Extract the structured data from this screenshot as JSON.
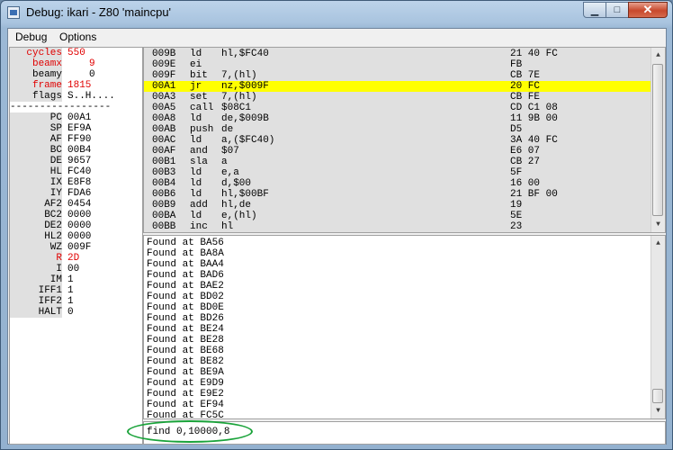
{
  "window": {
    "title": "Debug: ikari - Z80 'maincpu'"
  },
  "titlebar_buttons": {
    "minimize": "▁",
    "maximize": "□",
    "close": "✕"
  },
  "menu": [
    "Debug",
    "Options"
  ],
  "registers": [
    {
      "name": "cycles",
      "value": "550",
      "red": true
    },
    {
      "name": "beamx",
      "value": "9",
      "red": true
    },
    {
      "name": "beamy",
      "value": "0",
      "red": false
    },
    {
      "name": "frame",
      "value": "1815",
      "red": true
    },
    {
      "name": "flags",
      "value": "S..H....",
      "red": false
    },
    {
      "sep": "-----------------"
    },
    {
      "name": "PC",
      "value": "00A1",
      "red": false
    },
    {
      "name": "SP",
      "value": "EF9A",
      "red": false
    },
    {
      "name": "AF",
      "value": "FF90",
      "red": false
    },
    {
      "name": "BC",
      "value": "00B4",
      "red": false
    },
    {
      "name": "DE",
      "value": "9657",
      "red": false
    },
    {
      "name": "HL",
      "value": "FC40",
      "red": false
    },
    {
      "name": "IX",
      "value": "E8F8",
      "red": false
    },
    {
      "name": "IY",
      "value": "FDA6",
      "red": false
    },
    {
      "name": "AF2",
      "value": "0454",
      "red": false
    },
    {
      "name": "BC2",
      "value": "0000",
      "red": false
    },
    {
      "name": "DE2",
      "value": "0000",
      "red": false
    },
    {
      "name": "HL2",
      "value": "0000",
      "red": false
    },
    {
      "name": "WZ",
      "value": "009F",
      "red": false
    },
    {
      "name": "R",
      "value": "2D",
      "red": true
    },
    {
      "name": "I",
      "value": "00",
      "red": false
    },
    {
      "name": "IM",
      "value": "1",
      "red": false
    },
    {
      "name": "IFF1",
      "value": "1",
      "red": false
    },
    {
      "name": "IFF2",
      "value": "1",
      "red": false
    },
    {
      "name": "HALT",
      "value": "0",
      "red": false
    }
  ],
  "disassembly": [
    {
      "addr": "009B",
      "mnemonic": "ld",
      "operands": "hl,$FC40",
      "bytes": "21 40 FC",
      "highlight": false
    },
    {
      "addr": "009E",
      "mnemonic": "ei",
      "operands": "",
      "bytes": "FB",
      "highlight": false
    },
    {
      "addr": "009F",
      "mnemonic": "bit",
      "operands": "7,(hl)",
      "bytes": "CB 7E",
      "highlight": false
    },
    {
      "addr": "00A1",
      "mnemonic": "jr",
      "operands": "nz,$009F",
      "bytes": "20 FC",
      "highlight": true
    },
    {
      "addr": "00A3",
      "mnemonic": "set",
      "operands": "7,(hl)",
      "bytes": "CB FE",
      "highlight": false
    },
    {
      "addr": "00A5",
      "mnemonic": "call",
      "operands": "$08C1",
      "bytes": "CD C1 08",
      "highlight": false
    },
    {
      "addr": "00A8",
      "mnemonic": "ld",
      "operands": "de,$009B",
      "bytes": "11 9B 00",
      "highlight": false
    },
    {
      "addr": "00AB",
      "mnemonic": "push",
      "operands": "de",
      "bytes": "D5",
      "highlight": false
    },
    {
      "addr": "00AC",
      "mnemonic": "ld",
      "operands": "a,($FC40)",
      "bytes": "3A 40 FC",
      "highlight": false
    },
    {
      "addr": "00AF",
      "mnemonic": "and",
      "operands": "$07",
      "bytes": "E6 07",
      "highlight": false
    },
    {
      "addr": "00B1",
      "mnemonic": "sla",
      "operands": "a",
      "bytes": "CB 27",
      "highlight": false
    },
    {
      "addr": "00B3",
      "mnemonic": "ld",
      "operands": "e,a",
      "bytes": "5F",
      "highlight": false
    },
    {
      "addr": "00B4",
      "mnemonic": "ld",
      "operands": "d,$00",
      "bytes": "16 00",
      "highlight": false
    },
    {
      "addr": "00B6",
      "mnemonic": "ld",
      "operands": "hl,$00BF",
      "bytes": "21 BF 00",
      "highlight": false
    },
    {
      "addr": "00B9",
      "mnemonic": "add",
      "operands": "hl,de",
      "bytes": "19",
      "highlight": false
    },
    {
      "addr": "00BA",
      "mnemonic": "ld",
      "operands": "e,(hl)",
      "bytes": "5E",
      "highlight": false
    },
    {
      "addr": "00BB",
      "mnemonic": "inc",
      "operands": "hl",
      "bytes": "23",
      "highlight": false
    }
  ],
  "console_lines": [
    "Found at BA56",
    "Found at BA8A",
    "Found at BAA4",
    "Found at BAD6",
    "Found at BAE2",
    "Found at BD02",
    "Found at BD0E",
    "Found at BD26",
    "Found at BE24",
    "Found at BE28",
    "Found at BE68",
    "Found at BE82",
    "Found at BE9A",
    "Found at E9D9",
    "Found at E9E2",
    "Found at EF94",
    "Found at FC5C"
  ],
  "command_input": {
    "value": "find 0,10000,8"
  },
  "colors": {
    "highlight": "#ffff00",
    "register_red": "#e00000",
    "annotation_ellipse": "#1aa33a"
  },
  "icons": {
    "scroll_up": "▲",
    "scroll_down": "▼"
  }
}
